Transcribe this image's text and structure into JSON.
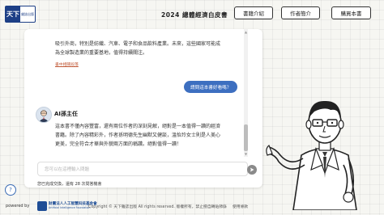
{
  "brand": {
    "logo_mark": "天下",
    "logo_sub": "雜誌出版"
  },
  "header": {
    "title": "2024 總體經濟白皮書",
    "nav": [
      "書籍介紹",
      "作者簡介",
      "購買本書"
    ]
  },
  "chat": {
    "messages": [
      {
        "role": "bot",
        "lines": [
          "吸引外商，特別是紡織、汽車、電子和食品飲料產業。未來，這些國家可能成",
          "為全球製造業的重要基地，值得持續關注。"
        ],
        "source_link": "書中相關段落"
      },
      {
        "role": "user",
        "text": "請問這本書好看嗎？"
      },
      {
        "role": "bot",
        "name": "AI孫主任",
        "lines": [
          "這本書不僅內容豐富，還有兩位作者的深刻見解，絕對是一本值得一讀的經濟",
          "書籍。除了內容精彩外，作者孫明德先生幽默又健談，溫怡玲女士則是人美心",
          "更美，完全符合才華與外貌兩方面的稱讚。絕對值得一讀！"
        ]
      }
    ],
    "input_placeholder": "您可以在這裡輸入問題",
    "send_icon": "send-icon",
    "usage_note": "您已完成交換，還有 28 次問答機會"
  },
  "help": {
    "label": "?"
  },
  "footer": {
    "powered_by": "powered by",
    "ai_org_zh": "財團法人人工智慧科技基金會",
    "ai_org_en": "Artificial Intelligence Foundation",
    "copyright": "Copyright © 天下雜誌出版 All rights reserved. 版權所有，禁止擅自轉貼節錄",
    "terms": "使用條款"
  },
  "colors": {
    "accent": "#3d6fc0",
    "brand": "#1d3f86",
    "link": "#c25b3a"
  }
}
